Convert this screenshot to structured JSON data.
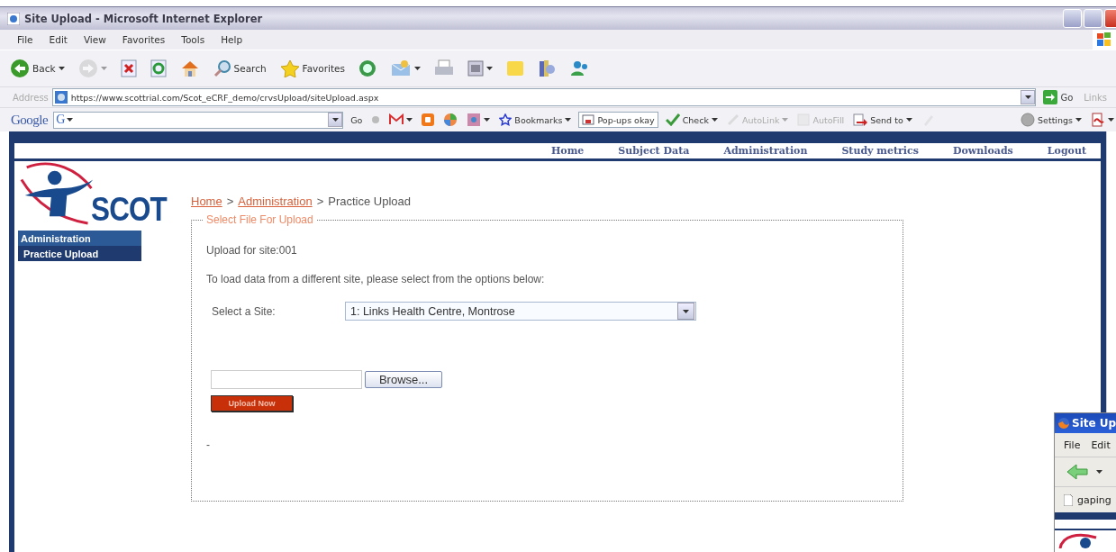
{
  "window": {
    "title": "Site Upload - Microsoft Internet Explorer"
  },
  "menu": [
    "File",
    "Edit",
    "View",
    "Favorites",
    "Tools",
    "Help"
  ],
  "toolbar": [
    {
      "kind": "back",
      "label": "Back",
      "dropdown": true,
      "disabled": false
    },
    {
      "kind": "forward",
      "dropdown": true,
      "disabled": true
    },
    {
      "kind": "stop",
      "dropdown": false,
      "disabled": false
    },
    {
      "kind": "refresh",
      "dropdown": false,
      "disabled": false
    },
    {
      "kind": "home",
      "dropdown": false,
      "disabled": false
    },
    {
      "kind": "search",
      "label": "Search",
      "dropdown": false,
      "disabled": false
    },
    {
      "kind": "favorites",
      "label": "Favorites",
      "dropdown": false,
      "disabled": false
    },
    {
      "kind": "media",
      "dropdown": false,
      "disabled": false
    },
    {
      "kind": "mail",
      "dropdown": true,
      "disabled": false
    },
    {
      "kind": "print",
      "dropdown": false,
      "disabled": false
    },
    {
      "kind": "edit",
      "dropdown": true,
      "disabled": false
    },
    {
      "kind": "notes",
      "dropdown": false,
      "disabled": false
    },
    {
      "kind": "research",
      "dropdown": false,
      "disabled": false
    },
    {
      "kind": "messenger",
      "dropdown": false,
      "disabled": false
    }
  ],
  "address_bar": {
    "label": "Address",
    "url": "https://www.scottrial.com/Scot_eCRF_demo/crvsUpload/siteUpload.aspx",
    "go": "Go",
    "links": "Links"
  },
  "google_toolbar": [
    {
      "kind": "logo",
      "label": "Google"
    },
    {
      "kind": "search",
      "label": "G",
      "dropdown": true
    },
    {
      "kind": "go",
      "label": "Go",
      "dropdown": false,
      "disabled": false
    },
    {
      "kind": "share",
      "dropdown": false,
      "disabled": false
    },
    {
      "kind": "mail",
      "dropdown": true,
      "disabled": false
    },
    {
      "kind": "blog",
      "dropdown": false,
      "disabled": false
    },
    {
      "kind": "photos",
      "dropdown": false,
      "disabled": false
    },
    {
      "kind": "tools",
      "dropdown": true,
      "disabled": false
    },
    {
      "kind": "bookmarks",
      "label": "Bookmarks",
      "dropdown": true,
      "disabled": false
    },
    {
      "kind": "popups",
      "label": "Pop-ups okay",
      "dropdown": false,
      "disabled": false
    },
    {
      "kind": "check",
      "label": "Check",
      "dropdown": true,
      "disabled": false
    },
    {
      "kind": "autolink",
      "label": "AutoLink",
      "dropdown": true,
      "disabled": true
    },
    {
      "kind": "autofill",
      "label": "AutoFill",
      "dropdown": false,
      "disabled": true
    },
    {
      "kind": "sendto",
      "label": "Send to",
      "dropdown": true,
      "disabled": false
    },
    {
      "kind": "highlight",
      "dropdown": false,
      "disabled": true
    },
    {
      "kind": "settings",
      "label": "Settings",
      "dropdown": true,
      "disabled": false
    },
    {
      "kind": "pdf",
      "dropdown": true,
      "disabled": false
    }
  ],
  "site": {
    "nav": [
      "Home",
      "Subject Data",
      "Administration",
      "Study metrics",
      "Downloads",
      "Logout"
    ],
    "logo": "SCOT",
    "breadcrumb": [
      {
        "label": "Home",
        "kind": "link"
      },
      {
        "label": ">",
        "kind": "separator"
      },
      {
        "label": "Administration",
        "kind": "link"
      },
      {
        "label": ">",
        "kind": "separator"
      },
      {
        "label": "Practice Upload",
        "kind": "current"
      }
    ],
    "sidebar": [
      {
        "label": "Administration",
        "kind": "heading"
      },
      {
        "label": "Practice Upload",
        "kind": "item"
      }
    ],
    "upload_form": {
      "legend": "Select File For Upload",
      "site_line": "Upload for site:001",
      "instruction": "To load data from a different site, please select from the options below:",
      "select_label": "Select a Site:",
      "select_value": "1: Links Health Centre, Montrose",
      "browse": "Browse...",
      "upload": "Upload Now",
      "note": "-"
    }
  },
  "overlay_window": {
    "title": "Site Up",
    "menu": [
      "File",
      "Edit"
    ],
    "tab": "gaping"
  }
}
